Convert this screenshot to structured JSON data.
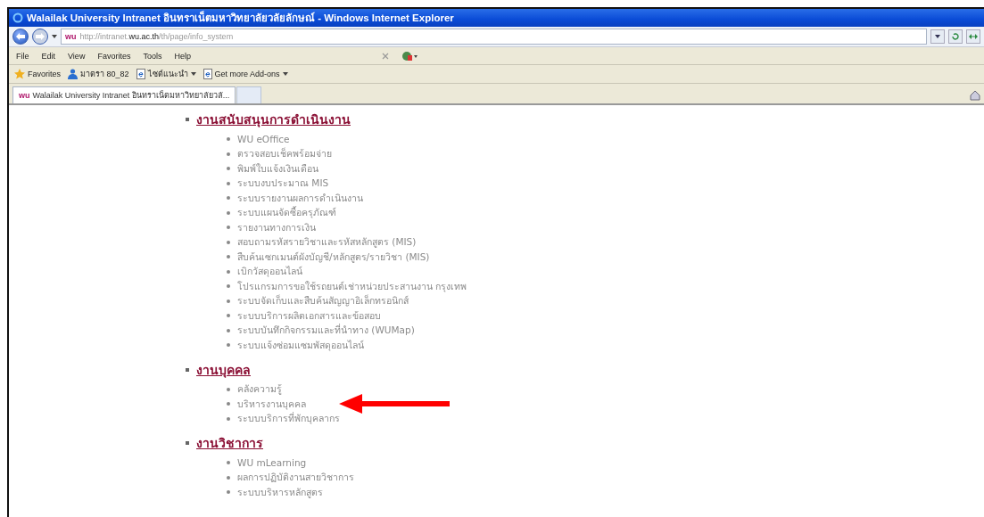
{
  "window": {
    "title": "Walailak University Intranet อินทราเน็ตมหาวิทยาลัยวลัยลักษณ์ - Windows Internet Explorer"
  },
  "address_bar": {
    "site_badge": "wu",
    "url_prefix": "http://intranet.",
    "url_domain": "wu.ac.th",
    "url_path": "/th/page/info_system"
  },
  "menu_bar": [
    "File",
    "Edit",
    "View",
    "Favorites",
    "Tools",
    "Help"
  ],
  "favorites_bar": [
    {
      "label": "Favorites",
      "kind": "star",
      "dropdown": false
    },
    {
      "label": "มาตรา 80_82",
      "kind": "person",
      "dropdown": false
    },
    {
      "label": "ไซต์แนะนำ",
      "kind": "page",
      "dropdown": true
    },
    {
      "label": "Get more Add-ons",
      "kind": "page",
      "dropdown": true
    }
  ],
  "tabs": [
    {
      "label": "Walailak University Intranet อินทราเน็ตมหาวิทยาลัยวลั...",
      "site_badge": "wu",
      "selected": true
    }
  ],
  "sections": [
    {
      "heading": "งานสนับสนุนการดำเนินงาน",
      "items": [
        {
          "label": "WU eOffice",
          "pointed": false
        },
        {
          "label": "ตรวจสอบเช็คพร้อมจ่าย",
          "pointed": false
        },
        {
          "label": "พิมพ์ใบแจ้งเงินเดือน",
          "pointed": false
        },
        {
          "label": "ระบบงบประมาณ MIS",
          "pointed": false
        },
        {
          "label": "ระบบรายงานผลการดำเนินงาน",
          "pointed": false
        },
        {
          "label": "ระบบแผนจัดซื้อครุภัณฑ์",
          "pointed": false
        },
        {
          "label": "รายงานทางการเงิน",
          "pointed": false
        },
        {
          "label": "สอบถามรหัสรายวิชาและรหัสหลักสูตร (MIS)",
          "pointed": false
        },
        {
          "label": "สืบค้นเซกเมนต์ผังบัญชี/หลักสูตร/รายวิชา (MIS)",
          "pointed": false
        },
        {
          "label": "เบิกวัสดุออนไลน์",
          "pointed": false
        },
        {
          "label": "โปรแกรมการขอใช้รถยนต์เช่าหน่วยประสานงาน กรุงเทพ",
          "pointed": false
        },
        {
          "label": "ระบบจัดเก็บและสืบค้นสัญญาอิเล็กทรอนิกส์",
          "pointed": false
        },
        {
          "label": "ระบบบริการผลิตเอกสารและข้อสอบ",
          "pointed": false
        },
        {
          "label": "ระบบบันทึกกิจกรรมและที่นำทาง (WUMap)",
          "pointed": false
        },
        {
          "label": "ระบบแจ้งซ่อมแซมพัสดุออนไลน์",
          "pointed": false
        }
      ]
    },
    {
      "heading": "งานบุคคล",
      "items": [
        {
          "label": "คลังความรู้",
          "pointed": false
        },
        {
          "label": "บริหารงานบุคคล",
          "pointed": true
        },
        {
          "label": "ระบบบริการที่พักบุคลากร",
          "pointed": false
        }
      ]
    },
    {
      "heading": "งานวิชาการ",
      "items": [
        {
          "label": "WU mLearning",
          "pointed": false
        },
        {
          "label": "ผลการปฏิบัติงานสายวิชาการ",
          "pointed": false
        },
        {
          "label": "ระบบบริหารหลักสูตร",
          "pointed": false
        }
      ]
    }
  ]
}
